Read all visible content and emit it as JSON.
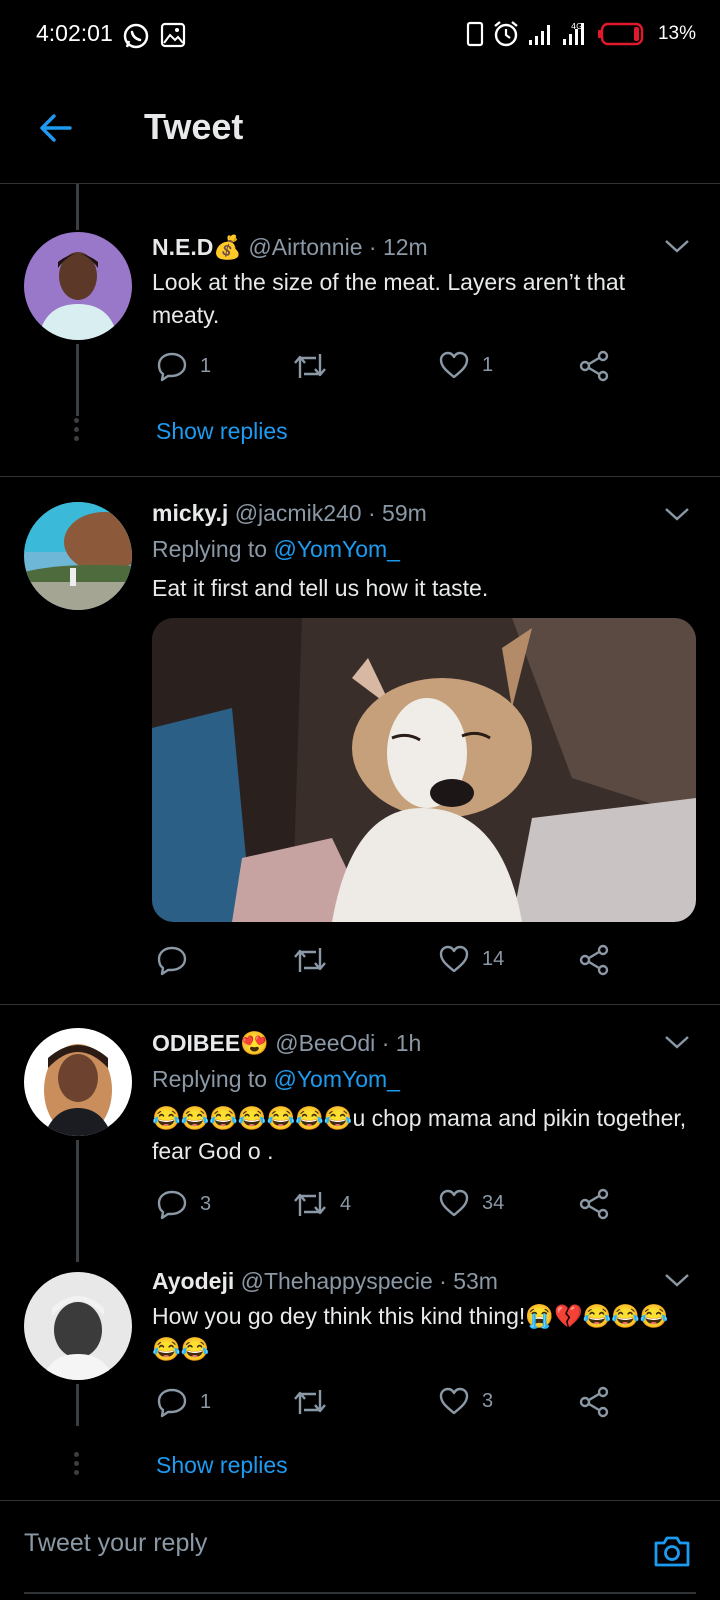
{
  "status": {
    "time": "4:02:01",
    "battery": "13%"
  },
  "header": {
    "title": "Tweet"
  },
  "tweets": [
    {
      "name": "N.E.D",
      "name_emoji": "💰",
      "handle": "@Airtonnie",
      "time": "· 12m",
      "text": "Look at the size of the meat. Layers aren’t that meaty.",
      "replies": "1",
      "retweets": "",
      "likes": "1",
      "show_replies": "Show replies"
    },
    {
      "name": "micky.j",
      "handle": "@jacmik240",
      "time": "· 59m",
      "replying_prefix": "Replying to",
      "replying_to": "@YomYom_",
      "text": "Eat it first and tell us how it taste.",
      "replies": "",
      "retweets": "",
      "likes": "14"
    },
    {
      "name": "ODIBEE",
      "name_emoji": "😍",
      "handle": "@BeeOdi",
      "time": "· 1h",
      "replying_prefix": "Replying to",
      "replying_to": "@YomYom_",
      "text": "😂😂😂😂😂😂😂u chop mama and pikin together, fear God o .",
      "replies": "3",
      "retweets": "4",
      "likes": "34"
    },
    {
      "name": "Ayodeji",
      "handle": "@Thehappyspecie",
      "time": "· 53m",
      "text": "How you go dey think this kind thing!😭💔😂😂😂😂😂",
      "replies": "1",
      "retweets": "",
      "likes": "3",
      "show_replies": "Show replies"
    }
  ],
  "compose": {
    "placeholder": "Tweet your reply"
  }
}
